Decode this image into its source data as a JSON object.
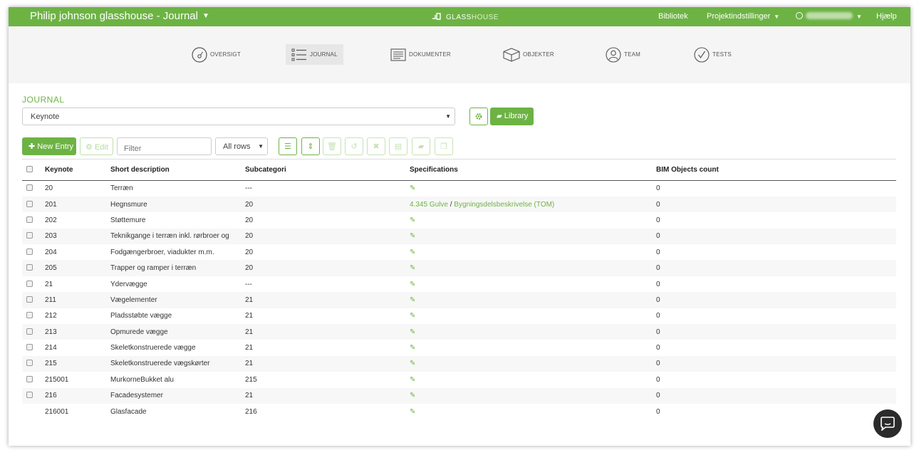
{
  "header": {
    "project_title": "Philip johnson glasshouse - Journal",
    "brand_main": "GLASS",
    "brand_accent": "HOUSE",
    "nav": {
      "library": "Bibliotek",
      "project_settings": "Projektindstillinger",
      "help": "Hjælp"
    }
  },
  "modules": [
    {
      "label": "OVERSIGT",
      "icon": "gauge-icon"
    },
    {
      "label": "JOURNAL",
      "icon": "list-icon"
    },
    {
      "label": "DOKUMENTER",
      "icon": "document-icon"
    },
    {
      "label": "OBJEKTER",
      "icon": "cube-icon"
    },
    {
      "label": "TEAM",
      "icon": "user-icon"
    },
    {
      "label": "TESTS",
      "icon": "check-circle-icon"
    }
  ],
  "journal": {
    "section_title": "JOURNAL",
    "selected_journal": "Keynote",
    "library_button": "Library"
  },
  "toolbar": {
    "new_entry": "New Entry",
    "edit": "Edit",
    "filter_placeholder": "Filter",
    "rows_option": "All rows"
  },
  "table": {
    "columns": [
      "Keynote",
      "Short description",
      "Subcategori",
      "Specifications",
      "BIM Objects count"
    ],
    "rows": [
      {
        "keynote": "20",
        "description": "Terræn",
        "subcategory": "---",
        "spec": "",
        "bim": "0",
        "checkbox": true
      },
      {
        "keynote": "201",
        "description": "Hegnsmure",
        "subcategory": "20",
        "spec_link1": "4.345 Gulve",
        "spec_sep": "/",
        "spec_link2": "Bygningsdelsbeskrivelse (TOM)",
        "bim": "0",
        "checkbox": true
      },
      {
        "keynote": "202",
        "description": "Støttemure",
        "subcategory": "20",
        "spec": "",
        "bim": "0",
        "checkbox": true
      },
      {
        "keynote": "203",
        "description": "Teknikgange i terræn inkl. rørbroer og",
        "subcategory": "20",
        "spec": "",
        "bim": "0",
        "checkbox": true
      },
      {
        "keynote": "204",
        "description": "Fodgængerbroer, viadukter m.m.",
        "subcategory": "20",
        "spec": "",
        "bim": "0",
        "checkbox": true
      },
      {
        "keynote": "205",
        "description": "Trapper og ramper i terræn",
        "subcategory": "20",
        "spec": "",
        "bim": "0",
        "checkbox": true
      },
      {
        "keynote": "21",
        "description": "Ydervægge",
        "subcategory": "---",
        "spec": "",
        "bim": "0",
        "checkbox": true
      },
      {
        "keynote": "211",
        "description": "Vægelementer",
        "subcategory": "21",
        "spec": "",
        "bim": "0",
        "checkbox": true
      },
      {
        "keynote": "212",
        "description": "Pladsstøbte vægge",
        "subcategory": "21",
        "spec": "",
        "bim": "0",
        "checkbox": true
      },
      {
        "keynote": "213",
        "description": "Opmurede vægge",
        "subcategory": "21",
        "spec": "",
        "bim": "0",
        "checkbox": true
      },
      {
        "keynote": "214",
        "description": "Skeletkonstruerede vægge",
        "subcategory": "21",
        "spec": "",
        "bim": "0",
        "checkbox": true
      },
      {
        "keynote": "215",
        "description": "Skeletkonstruerede vægskørter",
        "subcategory": "21",
        "spec": "",
        "bim": "0",
        "checkbox": true
      },
      {
        "keynote": "215001",
        "description": "MurkorneBukket alu",
        "subcategory": "215",
        "spec": "",
        "bim": "0",
        "checkbox": true
      },
      {
        "keynote": "216",
        "description": "Facadesystemer",
        "subcategory": "21",
        "spec": "",
        "bim": "0",
        "checkbox": true
      },
      {
        "keynote": "216001",
        "description": "Glasfacade",
        "subcategory": "216",
        "spec": "",
        "bim": "0",
        "checkbox": false
      }
    ]
  },
  "colors": {
    "accent": "#6db344",
    "header_bg": "#6db344",
    "module_bg": "#f5f5f5"
  }
}
